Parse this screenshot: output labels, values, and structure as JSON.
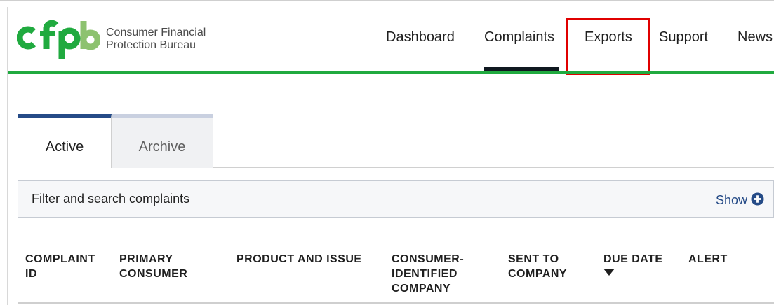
{
  "header": {
    "logo_text": "cfpb",
    "org_line1": "Consumer Financial",
    "org_line2": "Protection Bureau",
    "nav": [
      {
        "label": "Dashboard"
      },
      {
        "label": "Complaints",
        "active": true
      },
      {
        "label": "Exports",
        "highlighted": true
      },
      {
        "label": "Support"
      },
      {
        "label": "News"
      }
    ]
  },
  "tabs": [
    {
      "label": "Active",
      "active": true
    },
    {
      "label": "Archive",
      "active": false
    }
  ],
  "filter": {
    "label": "Filter and search complaints",
    "toggle_label": "Show"
  },
  "table": {
    "columns": [
      "COMPLAINT ID",
      "PRIMARY CONSUMER",
      "PRODUCT AND ISSUE",
      "CONSUMER-IDENTIFIED COMPANY",
      "SENT TO COMPANY",
      "DUE DATE",
      "ALERT"
    ],
    "sorted_column": "DUE DATE",
    "sort_direction": "descending"
  },
  "colors": {
    "brand_green": "#20aa3f",
    "logo_light_green": "#8dc26f",
    "navy": "#254b87",
    "highlight_red": "#e00000"
  }
}
